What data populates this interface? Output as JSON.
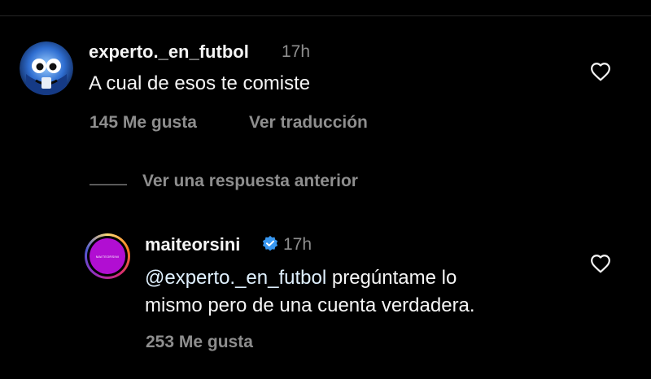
{
  "comment": {
    "username": "experto._en_futbol",
    "time": "17h",
    "text": "A cual de esos te comiste",
    "likes": "145 Me gusta",
    "translate": "Ver traducción"
  },
  "view_replies": "Ver una respuesta anterior",
  "reply": {
    "username": "maiteorsini",
    "time": "17h",
    "mention": "@experto._en_futbol",
    "text_line1_rest": " pregúntame lo",
    "text_line2": "mismo pero de una cuenta verdadera.",
    "likes": "253 Me gusta",
    "avatar_text": "MAITEORSINI"
  },
  "colors": {
    "background": "#000000",
    "secondary_text": "#8e8e8e",
    "mention": "#e0f1ff",
    "verified": "#3897f0",
    "reply_avatar": "#b10ed2"
  },
  "icons": [
    "heart-icon",
    "verified-badge-icon"
  ]
}
